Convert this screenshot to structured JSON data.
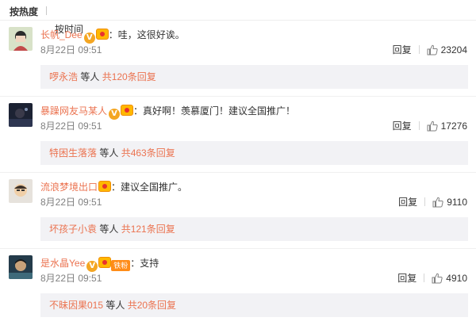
{
  "sort": {
    "hot_label": "按热度",
    "time_label": "按时间"
  },
  "colors": {
    "username": "#eb7350",
    "text": "#333333",
    "meta": "#808080",
    "sub_bg": "#f2f2f5",
    "verified_badge": "#f4a623"
  },
  "comments": [
    {
      "username": "长帆_Dee",
      "badges": [
        "verified-v-icon",
        "fan-badge-icon"
      ],
      "colon": "：",
      "text": "哇，这很好诶。",
      "time": "8月22日 09:51",
      "reply_label": "回复",
      "likes": "23204",
      "sub_user": "啰永浩",
      "sub_mid": " 等人 ",
      "sub_total": "共120条回复"
    },
    {
      "username": "暴躁网友马某人",
      "badges": [
        "verified-v-icon",
        "fan-badge-icon"
      ],
      "colon": "：",
      "text": "真好啊！羡慕厦门！建议全国推广！",
      "time": "8月22日 09:51",
      "reply_label": "回复",
      "likes": "17276",
      "sub_user": "特困生落落",
      "sub_mid": " 等人 ",
      "sub_total": "共463条回复"
    },
    {
      "username": "流浪梦境出口",
      "badges": [
        "fan-badge-icon"
      ],
      "colon": "：",
      "text": "建议全国推广。",
      "time": "8月22日 09:51",
      "reply_label": "回复",
      "likes": "9110",
      "sub_user": "坏孩子小袁",
      "sub_mid": " 等人 ",
      "sub_total": "共121条回复"
    },
    {
      "username": "是水晶Yee",
      "badges": [
        "verified-v-icon",
        "fan-badge-icon",
        "tiefen-badge-icon"
      ],
      "tiefen_label": "铁粉",
      "colon": "：",
      "text": "支持",
      "time": "8月22日 09:51",
      "reply_label": "回复",
      "likes": "4910",
      "sub_user": "不昧因果015",
      "sub_mid": " 等人 ",
      "sub_total": "共20条回复"
    }
  ]
}
